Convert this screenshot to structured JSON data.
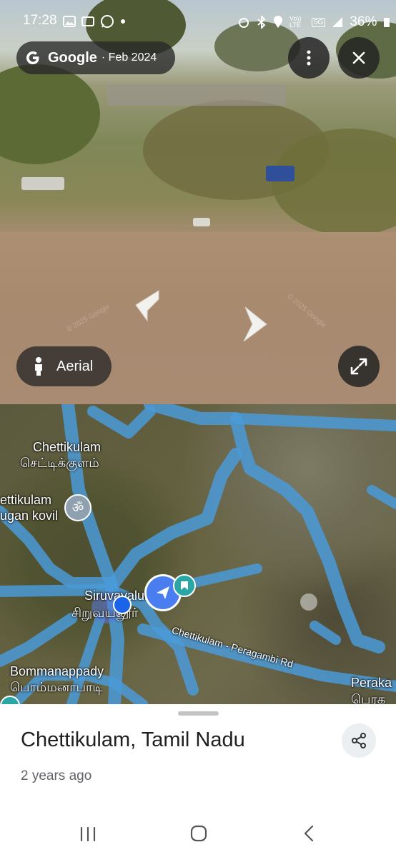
{
  "status_bar": {
    "time": "17:28",
    "network": "5G",
    "volte": "Vo)) LTE",
    "battery": "36%"
  },
  "street_view": {
    "provider": "Google",
    "date": "· Feb 2024",
    "aerial_label": "Aerial",
    "watermarks": [
      "© 2025 Google",
      "© 2025 Google"
    ]
  },
  "map": {
    "labels": {
      "chettikulam_en": "Chettikulam",
      "chettikulam_ta": "செட்டிக்குளம்",
      "temple_line1": "ettikulam",
      "temple_line2": "ugan kovil",
      "siruvayalur_en": "Siruvayalur",
      "siruvayalur_ta": "சிறுவயலூர்",
      "road": "Chettikulam - Peragambi Rd",
      "bommanappady_en": "Bommanappady",
      "bommanappady_ta": "பொம்மனாபாடி",
      "peraka_en": "Peraka",
      "peraka_ta": "பெரக"
    }
  },
  "place": {
    "title": "Chettikulam, Tamil Nadu",
    "age": "2 years ago"
  }
}
